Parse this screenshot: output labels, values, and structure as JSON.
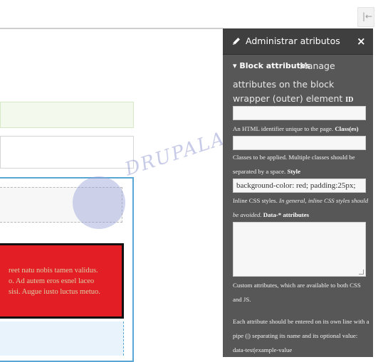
{
  "toolbar": {
    "collapse_icon": "|←"
  },
  "canvas": {
    "red_block_lines": [
      "reet natu nobis tamen validus.",
      "o. Ad autem eros esnel laceo",
      "sisi. Augue iusto luctus metuo."
    ],
    "watermark": "DRUPALADICTO"
  },
  "sidebar": {
    "title": "Administrar atributos",
    "close_label": "×",
    "section_heading": "▾ Block attributes",
    "manage_part1": "Manage",
    "manage_part2": "attributes on the block wrapper (outer) element",
    "id_label": "ID",
    "id_value": "",
    "id_help": "An HTML identifier unique to the page.",
    "class_label": "Class(es)",
    "class_value": "",
    "class_help": "Classes to be applied. Multiple classes should be separated by a space.",
    "style_label": "Style",
    "style_value": "background-color: red; padding:25px;",
    "style_help": "Inline CSS styles.",
    "style_help_italic": "In general, inline CSS styles should be avoided.",
    "data_label": "Data-* attributes",
    "data_value": "",
    "data_help": "Custom attributes, which are available to both CSS and JS.",
    "data_help2": "Each attribute should be entered on its own line with a pipe (|) separating its name and its optional value: data-test|example-value"
  },
  "colors": {
    "sidebar_bg": "#575757",
    "sidebar_header_bg": "#3f3f3f",
    "red_block": "#e31e24",
    "blue_outline": "#58a7d6"
  },
  "icons": [
    "collapse-sidebar-icon",
    "pencil-icon",
    "close-icon"
  ]
}
